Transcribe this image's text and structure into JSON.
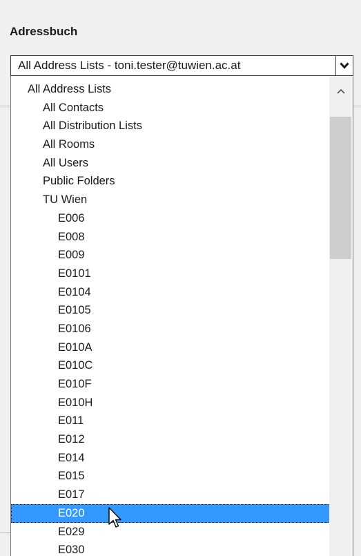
{
  "addressbook": {
    "label": "Adressbuch",
    "selected_value": "All Address Lists - toni.tester@tuwien.ac.at",
    "dropdown_icon": "chevron-down-icon"
  },
  "dropdown": {
    "items": [
      {
        "label": "All Address Lists",
        "level": 0
      },
      {
        "label": "All Contacts",
        "level": 1
      },
      {
        "label": "All Distribution Lists",
        "level": 1
      },
      {
        "label": "All Rooms",
        "level": 1
      },
      {
        "label": "All Users",
        "level": 1
      },
      {
        "label": "Public Folders",
        "level": 1
      },
      {
        "label": "TU Wien",
        "level": 1
      },
      {
        "label": "E006",
        "level": 2
      },
      {
        "label": "E008",
        "level": 2
      },
      {
        "label": "E009",
        "level": 2
      },
      {
        "label": "E0101",
        "level": 2
      },
      {
        "label": "E0104",
        "level": 2
      },
      {
        "label": "E0105",
        "level": 2
      },
      {
        "label": "E0106",
        "level": 2
      },
      {
        "label": "E010A",
        "level": 2
      },
      {
        "label": "E010C",
        "level": 2
      },
      {
        "label": "E010F",
        "level": 2
      },
      {
        "label": "E010H",
        "level": 2
      },
      {
        "label": "E011",
        "level": 2
      },
      {
        "label": "E012",
        "level": 2
      },
      {
        "label": "E014",
        "level": 2
      },
      {
        "label": "E015",
        "level": 2
      },
      {
        "label": "E017",
        "level": 2
      },
      {
        "label": "E020",
        "level": 2,
        "selected": true
      },
      {
        "label": "E029",
        "level": 2
      },
      {
        "label": "E030",
        "level": 2
      }
    ],
    "scroll_icon": "chevron-up-icon"
  },
  "colors": {
    "selection": "#3399ff",
    "background": "#f0f0f0"
  }
}
